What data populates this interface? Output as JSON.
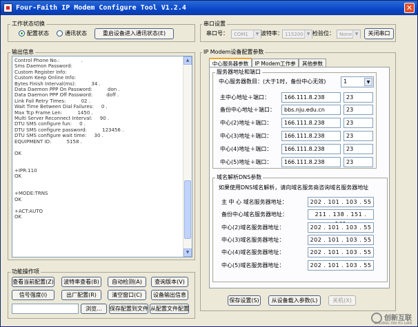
{
  "window": {
    "title": "Four-Faith IP Modem Configure Tool V1.2.4",
    "close_label": "✕"
  },
  "work_state": {
    "title": "工作状态切换",
    "config_label": "配置状态",
    "comm_label": "通讯状态",
    "selected": "config",
    "restart_button": "重启设备进入通讯状态(E)"
  },
  "serial": {
    "title": "串口设置",
    "port_label": "串口号：",
    "port_value": "COM1",
    "baud_label": "波特率：",
    "baud_value": "115200",
    "parity_label": "检验位：",
    "parity_value": "None",
    "close_button": "关闭串口"
  },
  "output": {
    "title": "输出信息",
    "lines": [
      "Control Phone No.:              .",
      "Sms Daemon Password:",
      "Custom Register Info:",
      "Custom Keep Online Info:",
      "Bytes Finish Interval(ms):          34 .",
      "Data Daemon PPP On Password:          don .",
      "Data Daemon PPP Off Password:         doff .",
      "Link Fail Retry Times:          02 .",
      "Wait Time Between Dial Failures:     0 .",
      "Max Tcp Frame Len:          1450 .",
      "Multi Server Reconnect Interval:     90 .",
      "DTU SMS configure fun:     0 .",
      "DTU SMS configure password:          123456 .",
      "DTU SMS configure wait time:     30 .",
      "EQUIPMENT ID:          5158 .",
      "",
      "OK",
      "",
      "",
      "+IPR:110",
      "OK",
      "",
      "",
      "+MODE:TRNS",
      "OK",
      "",
      "+ACT:AUTO",
      "OK"
    ]
  },
  "functions": {
    "title": "功能操作项",
    "buttons": {
      "view_current": "查看当前配置(Z)",
      "view_baud": "波特率查看(B)",
      "auto_detect": "自动检测(A)",
      "query_version": "查询版本(V)",
      "signal": "信号强度(I)",
      "factory": "出厂配置(R)",
      "clear_window": "清空窗口(C)",
      "save_output": "设备输出信息",
      "browse": "浏览...",
      "save_to_file": "保存配置到文件",
      "from_file": "从配置文件配置"
    },
    "file_path": ""
  },
  "ipmodem": {
    "title": "IP Modem设备配置参数",
    "tabs": [
      "中心服务器参数",
      "IP Modem工作参数",
      "其他参数"
    ],
    "active_tab": 0,
    "server_group_title": "服务器地址和端口",
    "server_count_label": "中心服务器数目：(大于1时，备份中心无效)",
    "server_count_value": "1",
    "servers": [
      {
        "label": "主中心地址＋端口：",
        "address": "166.111.8.238",
        "port": "23"
      },
      {
        "label": "备份中心地址＋端口：",
        "address": "bbs.nju.edu.cn",
        "port": "23"
      },
      {
        "label": "中心(2)地址＋端口：",
        "address": "166.111.8.238",
        "port": "23"
      },
      {
        "label": "中心(3)地址＋端口：",
        "address": "166.111.8.238",
        "port": "23"
      },
      {
        "label": "中心(4)地址＋端口：",
        "address": "166.111.8.238",
        "port": "23"
      },
      {
        "label": "中心(5)地址＋端口：",
        "address": "166.111.8.238",
        "port": "23"
      }
    ],
    "dns_group_title": "域名解析DNS参数",
    "dns_note": "如果使用DNS域名解析，请向域名服务商咨询域名服务器地址",
    "dns": [
      {
        "label": "主 中 心 域名服务器地址：",
        "ip": "202 . 101 . 103 . 55"
      },
      {
        "label": "备份中心域名服务器地址：",
        "ip": "211 . 138 . 151 . 161"
      },
      {
        "label": "中心(2)域名服务器地址：",
        "ip": "202 . 101 . 103 . 55"
      },
      {
        "label": "中心(3)域名服务器地址：",
        "ip": "202 . 101 . 103 . 55"
      },
      {
        "label": "中心(4)域名服务器地址：",
        "ip": "202 . 101 . 103 . 55"
      },
      {
        "label": "中心(5)域名服务器地址：",
        "ip": "202 . 101 . 103 . 55"
      }
    ]
  },
  "bottom": {
    "save_settings": "保存设置(S)",
    "load_params": "从设备载入参数(L)",
    "close": "关机(X)"
  },
  "watermark": {
    "text": "创新互联",
    "sub": "CHUANG XIN HU LIAN"
  }
}
